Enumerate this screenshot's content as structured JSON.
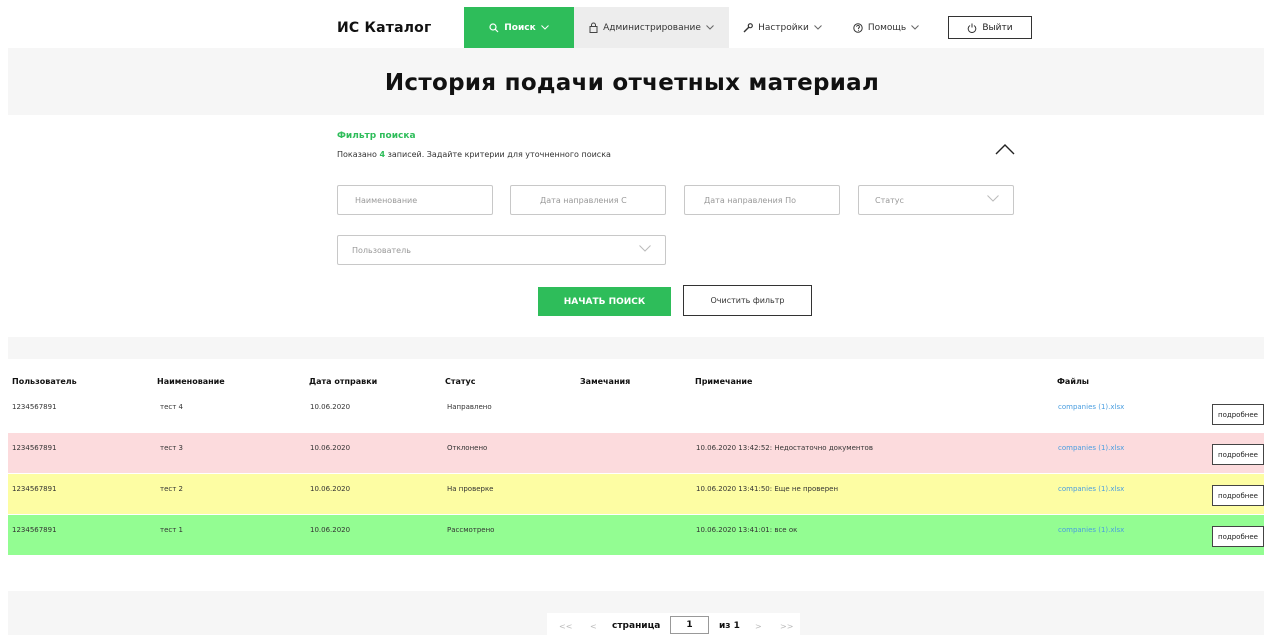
{
  "app": {
    "brand": "ИС Каталог"
  },
  "nav": {
    "search": {
      "label": "Поиск",
      "icon": "search-icon"
    },
    "admin": {
      "label": "Администрирование",
      "icon": "lock-icon"
    },
    "settings": {
      "label": "Настройки",
      "icon": "wrench-icon"
    },
    "help": {
      "label": "Помощь",
      "icon": "help-icon"
    },
    "logout": {
      "label": "Выйти",
      "icon": "power-icon"
    }
  },
  "page": {
    "title": "История подачи отчетных материал"
  },
  "filter": {
    "title": "Фильтр поиска",
    "info_prefix": "Показано",
    "count": "4",
    "info_suffix": "записей. Задайте критерии для уточненного поиска",
    "name_placeholder": "Наименование",
    "date_from_placeholder": "Дата направления С",
    "date_to_placeholder": "Дата направления По",
    "status_placeholder": "Статус",
    "user_placeholder": "Пользователь",
    "search_button": "НАЧАТЬ ПОИСК",
    "clear_button": "Очистить фильтр"
  },
  "table": {
    "headers": [
      "Пользователь",
      "Наименование",
      "Дата отправки",
      "Статус",
      "Замечания",
      "Примечание",
      "Файлы"
    ],
    "more_label": "подробнее",
    "rows": [
      {
        "user": "1234567891",
        "name": "тест 4",
        "date": "10.06.2020",
        "status": "Направлено",
        "remarks": "",
        "note": "",
        "file": "companies (1).xlsx",
        "bg": "#ffffff"
      },
      {
        "user": "1234567891",
        "name": "тест 3",
        "date": "10.06.2020",
        "status": "Отклонено",
        "remarks": "",
        "note": "10.06.2020 13:42:52: Недостаточно документов",
        "file": "companies (1).xlsx",
        "bg": "#fcdbdd"
      },
      {
        "user": "1234567891",
        "name": "тест 2",
        "date": "10.06.2020",
        "status": "На проверке",
        "remarks": "",
        "note": "10.06.2020 13:41:50: Еще не проверен",
        "file": "companies (1).xlsx",
        "bg": "#fdfda3"
      },
      {
        "user": "1234567891",
        "name": "тест 1",
        "date": "10.06.2020",
        "status": "Рассмотрено",
        "remarks": "",
        "note": "10.06.2020 13:41:01: все ок",
        "file": "companies (1).xlsx",
        "bg": "#93fd92"
      }
    ]
  },
  "pager": {
    "first": "<<",
    "prev": "<",
    "page_label": "страница",
    "current": "1",
    "of_label": "из 1",
    "next": ">",
    "last": ">>"
  },
  "colors": {
    "accent": "#2ebd5a",
    "admin_bg": "#ededed",
    "band_bg": "#f6f6f6",
    "link": "#4a9ee0"
  }
}
